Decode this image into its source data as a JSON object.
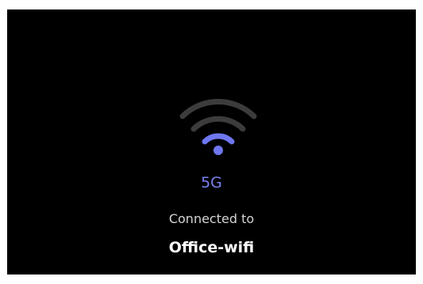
{
  "status": {
    "network_type": "5G",
    "connected_label": "Connected to",
    "network_name": "Office-wifi",
    "signal_bars_active": 1,
    "signal_bars_total": 3,
    "icon": "wifi-icon"
  },
  "colors": {
    "background": "#000000",
    "accent": "#6f77f0",
    "inactive_arc": "#3c3c3c",
    "network_type_text": "#7b82f0",
    "connected_text": "#d4d4d4",
    "network_name_text": "#ffffff"
  }
}
